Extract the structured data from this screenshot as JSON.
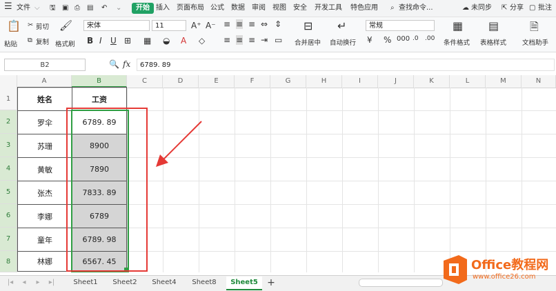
{
  "menubar": {
    "file": "文件",
    "tabs": [
      "开始",
      "插入",
      "页面布局",
      "公式",
      "数据",
      "审阅",
      "视图",
      "安全",
      "开发工具",
      "特色应用"
    ],
    "search": "查找命令...",
    "sync": "未同步",
    "share": "分享",
    "comment": "批注"
  },
  "ribbon": {
    "paste": "粘贴",
    "cut": "剪切",
    "copy": "复制",
    "format_painter": "格式刷",
    "font_name": "宋体",
    "font_size": "11",
    "merge_center": "合并居中",
    "wrap_text": "自动换行",
    "number_format": "常规",
    "conditional_format": "条件格式",
    "table_style": "表格样式",
    "doc_helper": "文档助手"
  },
  "formula_bar": {
    "cell_ref": "B2",
    "fx": "fx",
    "value": "6789. 89"
  },
  "columns": [
    "A",
    "B",
    "C",
    "D",
    "E",
    "F",
    "G",
    "H",
    "I",
    "J",
    "K",
    "L",
    "M",
    "N"
  ],
  "rows": [
    "1",
    "2",
    "3",
    "4",
    "5",
    "6",
    "7",
    "8"
  ],
  "table": {
    "headers": [
      "姓名",
      "工资"
    ],
    "rows": [
      [
        "罗伞",
        "6789. 89"
      ],
      [
        "苏珊",
        "8900"
      ],
      [
        "黄敏",
        "7890"
      ],
      [
        "张杰",
        "7833. 89"
      ],
      [
        "李娜",
        "6789"
      ],
      [
        "童年",
        "6789. 98"
      ],
      [
        "林娜",
        "6567. 45"
      ]
    ]
  },
  "sheet_tabs": [
    "Sheet1",
    "Sheet2",
    "Sheet4",
    "Sheet8",
    "Sheet5"
  ],
  "active_sheet": "Sheet5",
  "watermark": {
    "brand": "Office教程网",
    "url": "www.office26.com"
  },
  "colors": {
    "accent_green": "#20a164",
    "selection_green": "#2f9e44",
    "annotation_red": "#e53935",
    "logo_orange": "#f26a1b"
  }
}
